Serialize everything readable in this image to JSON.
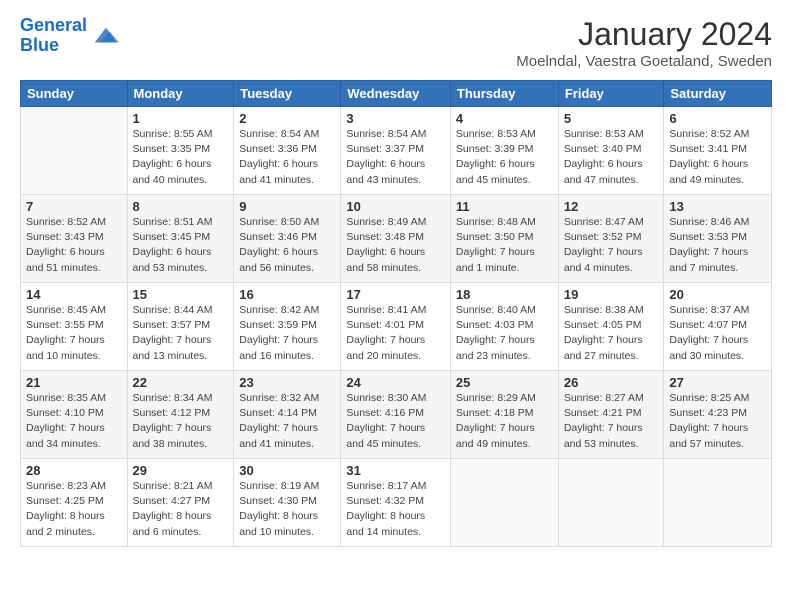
{
  "header": {
    "logo_line1": "General",
    "logo_line2": "Blue",
    "month": "January 2024",
    "location": "Moelndal, Vaestra Goetaland, Sweden"
  },
  "weekdays": [
    "Sunday",
    "Monday",
    "Tuesday",
    "Wednesday",
    "Thursday",
    "Friday",
    "Saturday"
  ],
  "weeks": [
    [
      {
        "day": "",
        "info": ""
      },
      {
        "day": "1",
        "info": "Sunrise: 8:55 AM\nSunset: 3:35 PM\nDaylight: 6 hours\nand 40 minutes."
      },
      {
        "day": "2",
        "info": "Sunrise: 8:54 AM\nSunset: 3:36 PM\nDaylight: 6 hours\nand 41 minutes."
      },
      {
        "day": "3",
        "info": "Sunrise: 8:54 AM\nSunset: 3:37 PM\nDaylight: 6 hours\nand 43 minutes."
      },
      {
        "day": "4",
        "info": "Sunrise: 8:53 AM\nSunset: 3:39 PM\nDaylight: 6 hours\nand 45 minutes."
      },
      {
        "day": "5",
        "info": "Sunrise: 8:53 AM\nSunset: 3:40 PM\nDaylight: 6 hours\nand 47 minutes."
      },
      {
        "day": "6",
        "info": "Sunrise: 8:52 AM\nSunset: 3:41 PM\nDaylight: 6 hours\nand 49 minutes."
      }
    ],
    [
      {
        "day": "7",
        "info": "Sunrise: 8:52 AM\nSunset: 3:43 PM\nDaylight: 6 hours\nand 51 minutes."
      },
      {
        "day": "8",
        "info": "Sunrise: 8:51 AM\nSunset: 3:45 PM\nDaylight: 6 hours\nand 53 minutes."
      },
      {
        "day": "9",
        "info": "Sunrise: 8:50 AM\nSunset: 3:46 PM\nDaylight: 6 hours\nand 56 minutes."
      },
      {
        "day": "10",
        "info": "Sunrise: 8:49 AM\nSunset: 3:48 PM\nDaylight: 6 hours\nand 58 minutes."
      },
      {
        "day": "11",
        "info": "Sunrise: 8:48 AM\nSunset: 3:50 PM\nDaylight: 7 hours\nand 1 minute."
      },
      {
        "day": "12",
        "info": "Sunrise: 8:47 AM\nSunset: 3:52 PM\nDaylight: 7 hours\nand 4 minutes."
      },
      {
        "day": "13",
        "info": "Sunrise: 8:46 AM\nSunset: 3:53 PM\nDaylight: 7 hours\nand 7 minutes."
      }
    ],
    [
      {
        "day": "14",
        "info": "Sunrise: 8:45 AM\nSunset: 3:55 PM\nDaylight: 7 hours\nand 10 minutes."
      },
      {
        "day": "15",
        "info": "Sunrise: 8:44 AM\nSunset: 3:57 PM\nDaylight: 7 hours\nand 13 minutes."
      },
      {
        "day": "16",
        "info": "Sunrise: 8:42 AM\nSunset: 3:59 PM\nDaylight: 7 hours\nand 16 minutes."
      },
      {
        "day": "17",
        "info": "Sunrise: 8:41 AM\nSunset: 4:01 PM\nDaylight: 7 hours\nand 20 minutes."
      },
      {
        "day": "18",
        "info": "Sunrise: 8:40 AM\nSunset: 4:03 PM\nDaylight: 7 hours\nand 23 minutes."
      },
      {
        "day": "19",
        "info": "Sunrise: 8:38 AM\nSunset: 4:05 PM\nDaylight: 7 hours\nand 27 minutes."
      },
      {
        "day": "20",
        "info": "Sunrise: 8:37 AM\nSunset: 4:07 PM\nDaylight: 7 hours\nand 30 minutes."
      }
    ],
    [
      {
        "day": "21",
        "info": "Sunrise: 8:35 AM\nSunset: 4:10 PM\nDaylight: 7 hours\nand 34 minutes."
      },
      {
        "day": "22",
        "info": "Sunrise: 8:34 AM\nSunset: 4:12 PM\nDaylight: 7 hours\nand 38 minutes."
      },
      {
        "day": "23",
        "info": "Sunrise: 8:32 AM\nSunset: 4:14 PM\nDaylight: 7 hours\nand 41 minutes."
      },
      {
        "day": "24",
        "info": "Sunrise: 8:30 AM\nSunset: 4:16 PM\nDaylight: 7 hours\nand 45 minutes."
      },
      {
        "day": "25",
        "info": "Sunrise: 8:29 AM\nSunset: 4:18 PM\nDaylight: 7 hours\nand 49 minutes."
      },
      {
        "day": "26",
        "info": "Sunrise: 8:27 AM\nSunset: 4:21 PM\nDaylight: 7 hours\nand 53 minutes."
      },
      {
        "day": "27",
        "info": "Sunrise: 8:25 AM\nSunset: 4:23 PM\nDaylight: 7 hours\nand 57 minutes."
      }
    ],
    [
      {
        "day": "28",
        "info": "Sunrise: 8:23 AM\nSunset: 4:25 PM\nDaylight: 8 hours\nand 2 minutes."
      },
      {
        "day": "29",
        "info": "Sunrise: 8:21 AM\nSunset: 4:27 PM\nDaylight: 8 hours\nand 6 minutes."
      },
      {
        "day": "30",
        "info": "Sunrise: 8:19 AM\nSunset: 4:30 PM\nDaylight: 8 hours\nand 10 minutes."
      },
      {
        "day": "31",
        "info": "Sunrise: 8:17 AM\nSunset: 4:32 PM\nDaylight: 8 hours\nand 14 minutes."
      },
      {
        "day": "",
        "info": ""
      },
      {
        "day": "",
        "info": ""
      },
      {
        "day": "",
        "info": ""
      }
    ]
  ]
}
